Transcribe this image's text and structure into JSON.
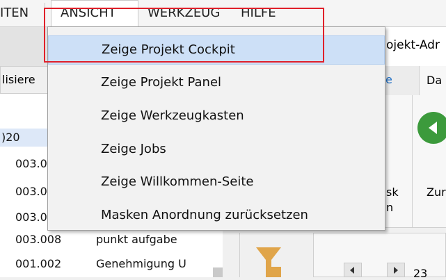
{
  "menubar": {
    "items": [
      {
        "label": "ITEN"
      },
      {
        "label": "ANSICHT"
      },
      {
        "label": "WERKZEUG"
      },
      {
        "label": "HILFE"
      }
    ]
  },
  "row2": {
    "right_text": "ojekt-Adr"
  },
  "left_panel": {
    "header": "lisiere",
    "rows": [
      {
        "code": ")20",
        "text": ""
      },
      {
        "code": "003.0",
        "text": ""
      },
      {
        "code": "003.0",
        "text": ""
      },
      {
        "code": "003.0",
        "text": ""
      },
      {
        "code": "003.008",
        "text": "punkt aufgabe"
      },
      {
        "code": "001.002",
        "text": "Genehmigung U"
      }
    ]
  },
  "right_area": {
    "tab_e": "e",
    "tab_da": "Da",
    "label_sk": "sk",
    "label_n": "n",
    "label_zur": "Zur",
    "page_num": "23"
  },
  "dropdown": {
    "items": [
      {
        "label": "Zeige Projekt Cockpit"
      },
      {
        "label": "Zeige Projekt Panel"
      },
      {
        "label": "Zeige Werkzeugkasten"
      },
      {
        "label": "Zeige Jobs"
      },
      {
        "label": "Zeige Willkommen-Seite"
      },
      {
        "label": "Masken Anordnung zurücksetzen"
      }
    ]
  },
  "colors": {
    "highlight_border": "#e0202a",
    "selected_item": "#cde0f7",
    "green_button": "#3c9a3c",
    "funnel": "#e0a54a"
  }
}
